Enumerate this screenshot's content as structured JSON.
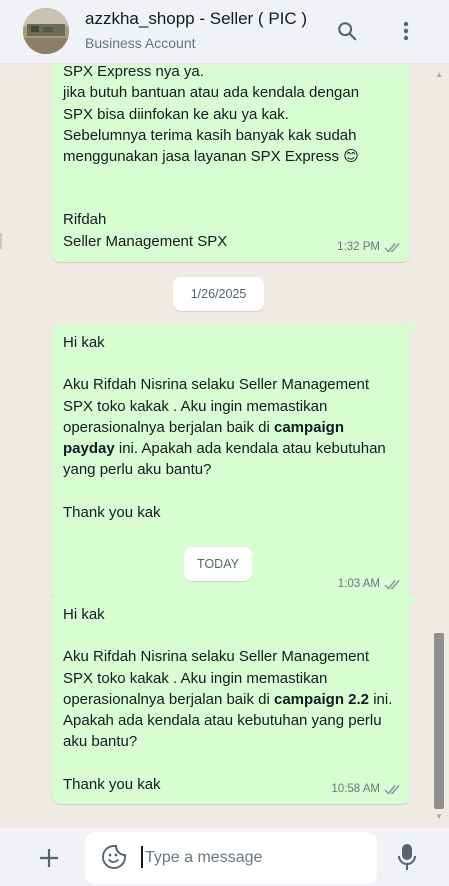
{
  "header": {
    "title": "azzkha_shopp - Seller ( PIC )",
    "subtitle": "Business Account",
    "search_icon": "search-icon",
    "menu_icon": "more-vertical-icon"
  },
  "messages": [
    {
      "lines": [
        "SPX Express nya ya.",
        "jika butuh bantuan atau ada kendala dengan",
        "SPX bisa diinfokan ke aku ya kak.",
        "Sebelumnya terima kasih banyak kak sudah",
        "menggunakan jasa layanan SPX Express"
      ],
      "emoji": "😊",
      "signature": [
        "Rifdah",
        "Seller Management SPX"
      ],
      "time": "1:32 PM"
    },
    {
      "greeting": "Hi kak",
      "body_start": "Aku Rifdah Nisrina selaku Seller Management SPX toko kakak . Aku ingin memastikan operasionalnya berjalan baik di ",
      "bold": "campaign payday",
      "body_end": " ini. Apakah ada kendala atau kebutuhan yang perlu aku bantu?",
      "closing": "Thank you kak",
      "time": "1:03 AM"
    },
    {
      "greeting": "Hi kak",
      "body_start": "Aku Rifdah Nisrina selaku Seller Management SPX toko kakak . Aku ingin memastikan operasionalnya berjalan baik di ",
      "bold": "campaign 2.2",
      "body_end": " ini. Apakah ada kendala atau kebutuhan yang perlu aku bantu?",
      "closing": "Thank you kak",
      "time": "10:58 AM"
    }
  ],
  "date_separators": [
    "1/26/2025",
    "TODAY"
  ],
  "composer": {
    "placeholder": "Type a message",
    "plus_icon": "plus-icon",
    "sticker_icon": "sticker-icon",
    "mic_icon": "microphone-icon"
  },
  "colors": {
    "outgoing_bubble": "#d9fdd3",
    "chat_background": "#efeae2",
    "header_background": "#f0f2f5"
  }
}
